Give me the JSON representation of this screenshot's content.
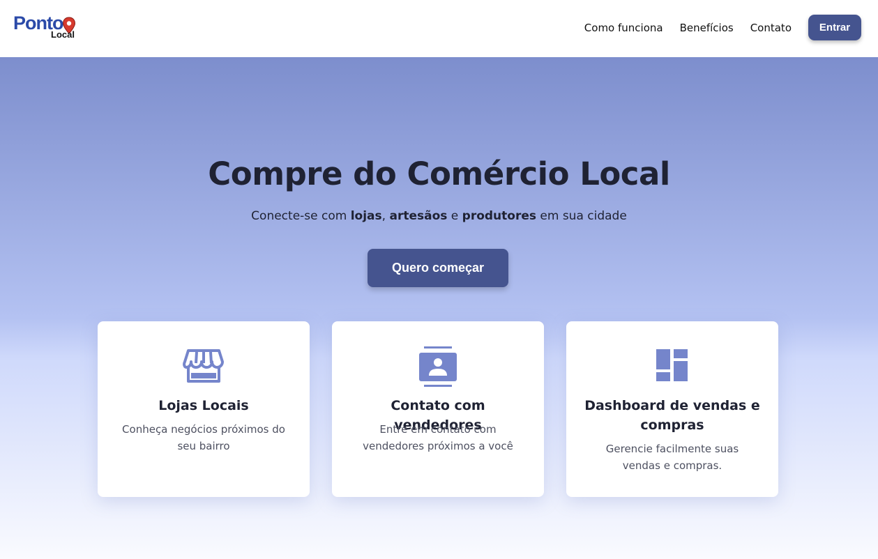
{
  "brand": {
    "name_top": "Ponto",
    "name_bottom": "Local",
    "accent_color": "#2b4aa8",
    "pin_color": "#d63a2e"
  },
  "nav": {
    "links": [
      "Como funciona",
      "Benefícios",
      "Contato"
    ],
    "login_label": "Entrar"
  },
  "hero": {
    "title": "Compre do Comércio Local",
    "subtitle_parts": [
      "Conecte-se com ",
      "lojas",
      ", ",
      "artesãos",
      " e ",
      "produtores",
      " em sua cidade"
    ],
    "cta_label": "Quero começar"
  },
  "cards": [
    {
      "icon": "store-icon",
      "title": "Lojas Locais",
      "text": "Conheça negócios próximos do seu bairro"
    },
    {
      "icon": "contact-icon",
      "title": "Contato com vendedores",
      "text": "Entre em contato com vendedores próximos a você"
    },
    {
      "icon": "dashboard-icon",
      "title": "Dashboard de vendas e compras",
      "text": "Gerencie facilmente suas vendas e compras."
    }
  ],
  "colors": {
    "button": "#45548f",
    "icon": "#7585cb"
  }
}
